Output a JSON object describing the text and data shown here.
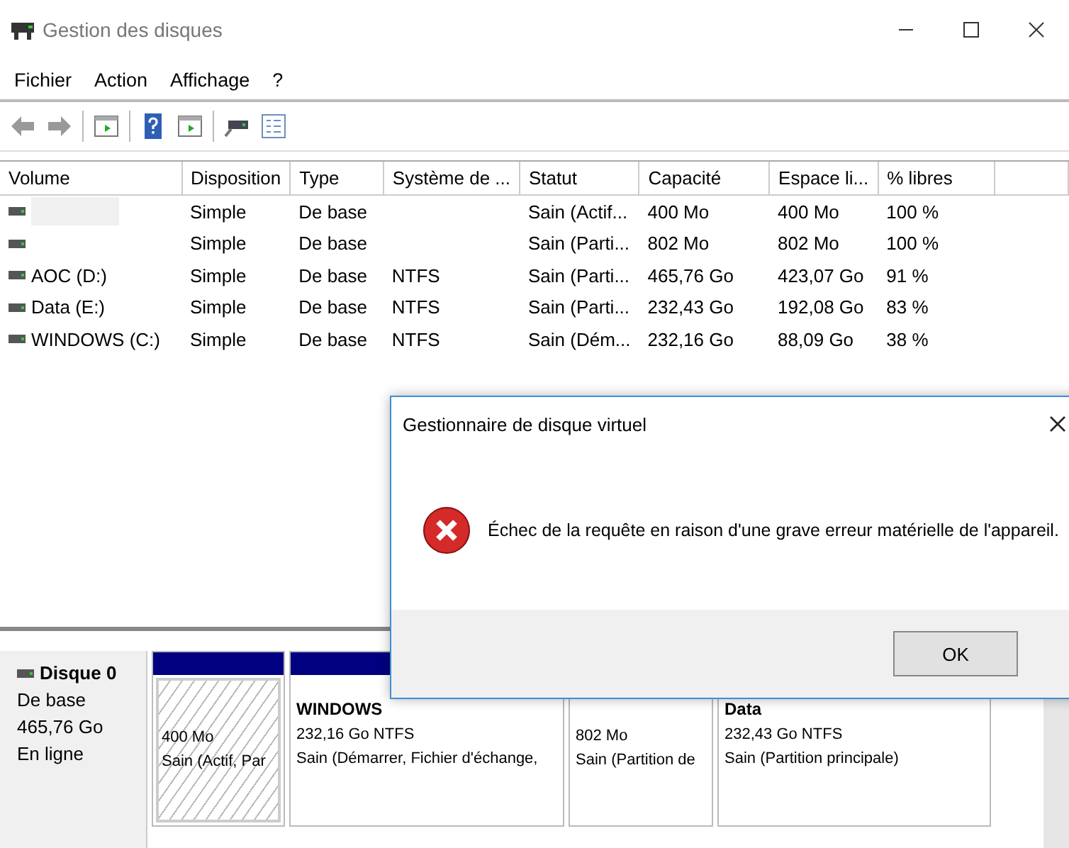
{
  "window": {
    "title": "Gestion des disques"
  },
  "menu": [
    "Fichier",
    "Action",
    "Affichage",
    "?"
  ],
  "table": {
    "columns": [
      "Volume",
      "Disposition",
      "Type",
      "Système de ...",
      "Statut",
      "Capacité",
      "Espace li...",
      "% libres"
    ],
    "rows": [
      {
        "cells": [
          "",
          "Simple",
          "De base",
          "",
          "Sain (Actif...",
          "400 Mo",
          "400 Mo",
          "100 %"
        ]
      },
      {
        "cells": [
          "",
          "Simple",
          "De base",
          "",
          "Sain (Parti...",
          "802 Mo",
          "802 Mo",
          "100 %"
        ]
      },
      {
        "cells": [
          "AOC (D:)",
          "Simple",
          "De base",
          "NTFS",
          "Sain (Parti...",
          "465,76 Go",
          "423,07 Go",
          "91 %"
        ]
      },
      {
        "cells": [
          "Data (E:)",
          "Simple",
          "De base",
          "NTFS",
          "Sain (Parti...",
          "232,43 Go",
          "192,08 Go",
          "83 %"
        ]
      },
      {
        "cells": [
          "WINDOWS (C:)",
          "Simple",
          "De base",
          "NTFS",
          "Sain (Dém...",
          "232,16 Go",
          "88,09 Go",
          "38 %"
        ]
      }
    ]
  },
  "disk": {
    "name": "Disque 0",
    "type": "De base",
    "size": "465,76 Go",
    "status": "En ligne",
    "partitions": [
      {
        "kind": "hatched",
        "lines": [
          "400 Mo",
          "Sain (Actif, Par"
        ]
      },
      {
        "kind": "plain",
        "title": "WINDOWS",
        "lines": [
          "232,16 Go NTFS",
          "Sain (Démarrer, Fichier d'échange,"
        ]
      },
      {
        "kind": "plain",
        "lines": [
          "802 Mo",
          "Sain (Partition de"
        ]
      },
      {
        "kind": "plain",
        "title": "Data",
        "lines": [
          "232,43 Go NTFS",
          "Sain (Partition principale)"
        ]
      }
    ]
  },
  "dialog": {
    "title": "Gestionnaire de disque virtuel",
    "message": "Échec de la requête en raison d'une grave erreur matérielle de l'appareil.",
    "button": "OK"
  }
}
